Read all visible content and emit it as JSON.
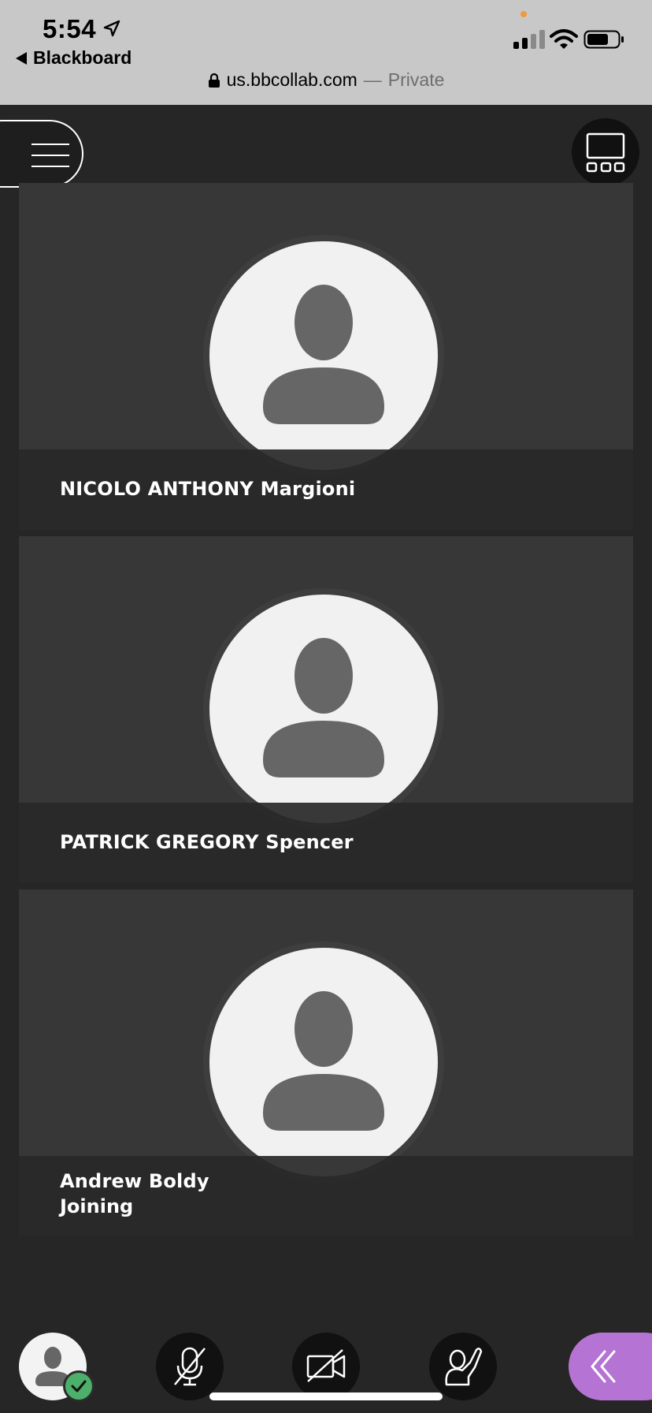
{
  "status_bar": {
    "time": "5:54",
    "back_app": "Blackboard",
    "url": "us.bbcollab.com",
    "url_separator": "—",
    "browsing_mode": "Private"
  },
  "top_controls": {
    "menu_icon": "hamburger-icon",
    "layout_icon": "gallery-layout-icon"
  },
  "participants": [
    {
      "name": "NICOLO ANTHONY Margioni",
      "status": ""
    },
    {
      "name": "PATRICK GREGORY Spencer",
      "status": ""
    },
    {
      "name": "Andrew Boldy",
      "status": "Joining"
    }
  ],
  "bottom_bar": {
    "my_status_icon": "avatar-icon",
    "my_status_badge": "check-icon",
    "microphone_icon": "microphone-muted-icon",
    "camera_icon": "camera-off-icon",
    "hand_icon": "raise-hand-icon",
    "collab_panel_icon": "double-chevron-left-icon"
  },
  "colors": {
    "background": "#262626",
    "tile": "#373737",
    "accent_purple": "#b573d3",
    "status_green": "#4caf6a",
    "location_dot": "#f09a3a"
  }
}
